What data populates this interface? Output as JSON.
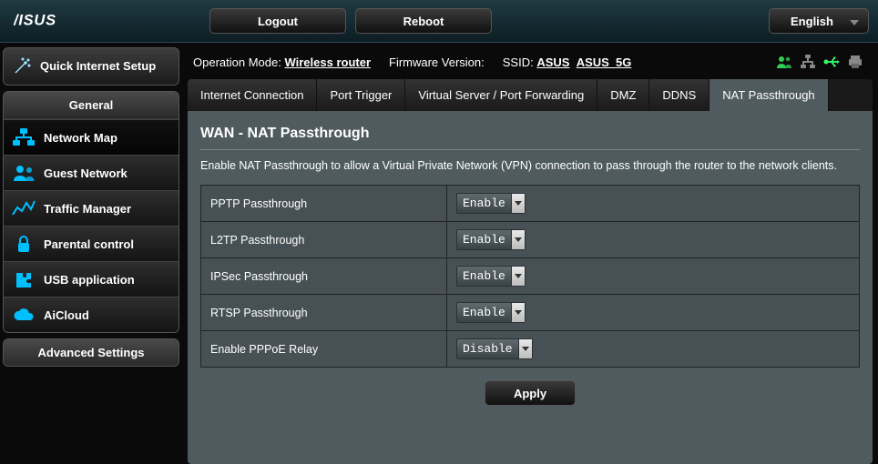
{
  "topbar": {
    "logout": "Logout",
    "reboot": "Reboot",
    "language": "English"
  },
  "info": {
    "op_mode_label": "Operation Mode:",
    "op_mode_value": "Wireless router",
    "firmware_label": "Firmware Version:",
    "ssid_label": "SSID:",
    "ssid1": "ASUS",
    "ssid2": "ASUS_5G"
  },
  "sidebar": {
    "quick_setup": "Quick Internet Setup",
    "general_header": "General",
    "items": [
      {
        "label": "Network Map"
      },
      {
        "label": "Guest Network"
      },
      {
        "label": "Traffic Manager"
      },
      {
        "label": "Parental control"
      },
      {
        "label": "USB application"
      },
      {
        "label": "AiCloud"
      }
    ],
    "advanced_header": "Advanced Settings"
  },
  "tabs": [
    "Internet Connection",
    "Port Trigger",
    "Virtual Server / Port Forwarding",
    "DMZ",
    "DDNS",
    "NAT Passthrough"
  ],
  "panel": {
    "title": "WAN - NAT Passthrough",
    "description": "Enable NAT Passthrough to allow a Virtual Private Network (VPN) connection to pass through the router to the network clients.",
    "rows": [
      {
        "label": "PPTP Passthrough",
        "value": "Enable"
      },
      {
        "label": "L2TP Passthrough",
        "value": "Enable"
      },
      {
        "label": "IPSec Passthrough",
        "value": "Enable"
      },
      {
        "label": "RTSP Passthrough",
        "value": "Enable"
      },
      {
        "label": "Enable PPPoE Relay",
        "value": "Disable"
      }
    ],
    "apply": "Apply"
  },
  "colors": {
    "accent": "#00bfff",
    "usb_green": "#33ff66"
  }
}
